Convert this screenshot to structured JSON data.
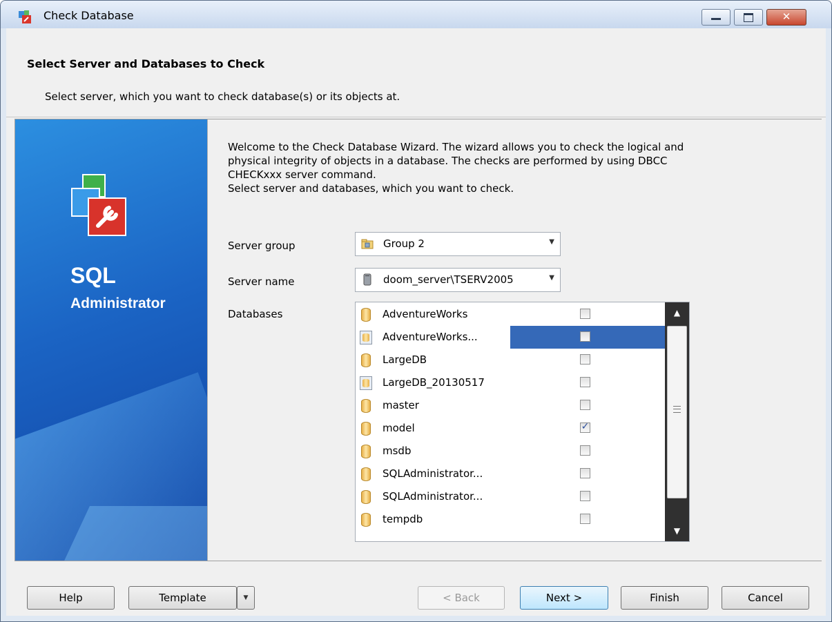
{
  "window": {
    "title": "Check Database"
  },
  "header": {
    "title": "Select Server and Databases to Check",
    "subtitle": "Select server, which you want to check database(s) or its objects at."
  },
  "banner": {
    "product_line1": "SQL",
    "product_line2": "Administrator"
  },
  "welcome": {
    "line1": "Welcome to the Check Database Wizard. The wizard allows you to check the logical and",
    "line2": "physical integrity of objects in a database. The checks are performed by using DBCC",
    "line3": "CHECKxxx server command.",
    "line4": "Select server and databases, which you want to check."
  },
  "form": {
    "server_group_label": "Server group",
    "server_group_value": "Group 2",
    "server_name_label": "Server name",
    "server_name_value": "doom_server\\TSERV2005",
    "databases_label": "Databases"
  },
  "databases": [
    {
      "name": "AdventureWorks",
      "checked": false,
      "selected": false,
      "offline": false
    },
    {
      "name": "AdventureWorks...",
      "checked": false,
      "selected": true,
      "offline": true
    },
    {
      "name": "LargeDB",
      "checked": false,
      "selected": false,
      "offline": false
    },
    {
      "name": "LargeDB_20130517",
      "checked": false,
      "selected": false,
      "offline": true
    },
    {
      "name": "master",
      "checked": false,
      "selected": false,
      "offline": false
    },
    {
      "name": "model",
      "checked": true,
      "selected": false,
      "offline": false
    },
    {
      "name": "msdb",
      "checked": false,
      "selected": false,
      "offline": false
    },
    {
      "name": "SQLAdministrator...",
      "checked": false,
      "selected": false,
      "offline": false
    },
    {
      "name": "SQLAdministrator...",
      "checked": false,
      "selected": false,
      "offline": false
    },
    {
      "name": "tempdb",
      "checked": false,
      "selected": false,
      "offline": false
    }
  ],
  "footer": {
    "help": "Help",
    "template": "Template",
    "back": "< Back",
    "next": "Next >",
    "finish": "Finish",
    "cancel": "Cancel"
  },
  "icons": {
    "app": "check-database-app-icon",
    "server_group": "folder-group-icon",
    "server": "server-icon",
    "database": "database-icon"
  }
}
